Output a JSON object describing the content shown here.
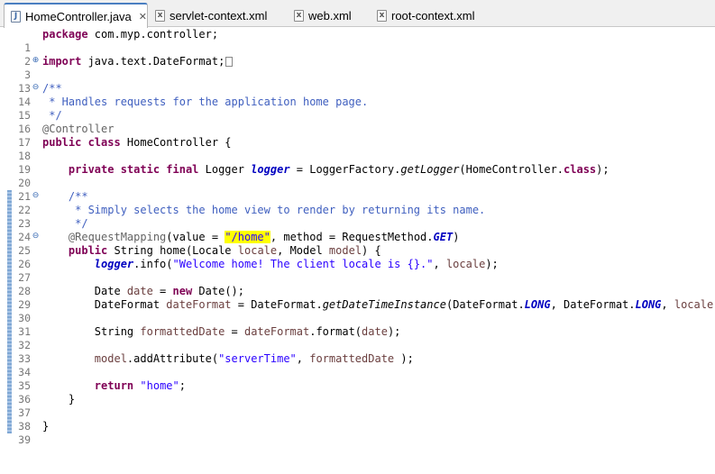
{
  "tabs": [
    {
      "label": "HomeController.java",
      "icon": "java-file-icon",
      "active": true,
      "close": "✕"
    },
    {
      "label": "servlet-context.xml",
      "icon": "xml-file-icon",
      "active": false
    },
    {
      "label": "web.xml",
      "icon": "xml-file-icon",
      "active": false
    },
    {
      "label": "root-context.xml",
      "icon": "xml-file-icon",
      "active": false
    }
  ],
  "editor": {
    "line_numbers": [
      "1",
      "2",
      "3",
      "13",
      "14",
      "15",
      "16",
      "17",
      "18",
      "19",
      "20",
      "21",
      "22",
      "23",
      "24",
      "25",
      "26",
      "27",
      "28",
      "29",
      "30",
      "31",
      "32",
      "33",
      "34",
      "35",
      "36",
      "37",
      "38",
      "39"
    ],
    "lines": {
      "l1": {
        "kw": "package",
        "rest": " com.myp.controller;"
      },
      "l3": {
        "kw": "import",
        "rest": " java.text.DateFormat;"
      },
      "l14": "/**",
      "l15": " * Handles requests for the application home page.",
      "l16": " */",
      "l17": "@Controller",
      "l18": {
        "kw": "public class",
        "rest": " HomeController {"
      },
      "l20": {
        "kw": "private static final",
        "t1": " Logger ",
        "fld": "logger",
        "t2": " = LoggerFactory.",
        "sm": "getLogger",
        "t3": "(HomeController.",
        "kw2": "class",
        "t4": ");"
      },
      "l22": "/**",
      "l23": " * Simply selects the home view to render by returning its name.",
      "l24": " */",
      "l25": {
        "an": "@RequestMapping",
        "t1": "(value = ",
        "str": "\"/home\"",
        "t2": ", method = RequestMethod.",
        "sfld": "GET",
        "t3": ")"
      },
      "l26": {
        "kw": "public",
        "t1": " String home(Locale ",
        "p1": "locale",
        "t2": ", Model ",
        "p2": "model",
        "t3": ") {"
      },
      "l27": {
        "fld": "logger",
        "t1": ".info(",
        "str": "\"Welcome home! The client locale is {}.\"",
        "t2": ", ",
        "v": "locale",
        "t3": ");"
      },
      "l29": {
        "t1": "Date ",
        "v": "date",
        "t2": " = ",
        "kw": "new",
        "t3": " Date();"
      },
      "l30": {
        "t1": "DateFormat ",
        "v": "dateFormat",
        "t2": " = DateFormat.",
        "sm": "getDateTimeInstance",
        "t3": "(DateFormat.",
        "s1": "LONG",
        "t4": ", DateFormat.",
        "s2": "LONG",
        "t5": ", ",
        "v2": "locale",
        "t6": ");"
      },
      "l32": {
        "t1": "String ",
        "v": "formattedDate",
        "t2": " = ",
        "v2": "dateFormat",
        "t3": ".format(",
        "v3": "date",
        "t4": ");"
      },
      "l34": {
        "t1": "model",
        "t2": ".addAttribute(",
        "str": "\"serverTime\"",
        "t3": ", ",
        "v": "formattedDate",
        "t4": " );"
      },
      "l36": {
        "kw": "return",
        "t1": " ",
        "str": "\"home\"",
        "t2": ";"
      },
      "l37": "}",
      "l39": "}"
    }
  }
}
